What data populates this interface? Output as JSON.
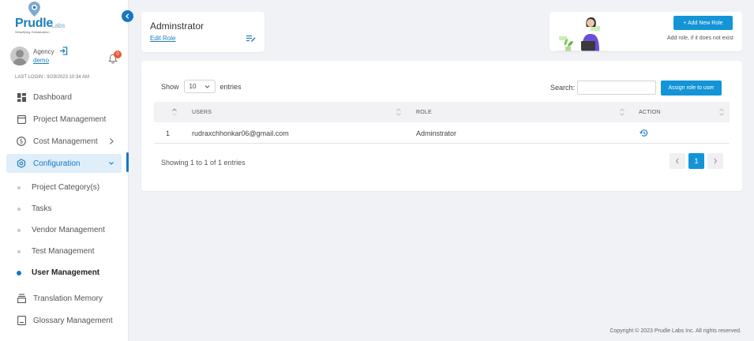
{
  "logo": {
    "brand": "Prudle",
    "brand_suffix": "Labs",
    "tagline": "Simplifying Globalization"
  },
  "user": {
    "role": "Agency",
    "name": "demo",
    "notifications": "0"
  },
  "last_login": "LAST LOGIN : 9/29/2023 10:34 AM",
  "sidebar": {
    "items": [
      {
        "label": "Dashboard",
        "icon": "dashboard-icon"
      },
      {
        "label": "Project Management",
        "icon": "project-icon"
      },
      {
        "label": "Cost Management",
        "icon": "dollar-icon"
      },
      {
        "label": "Configuration",
        "icon": "gear-icon"
      }
    ],
    "sub_items": [
      {
        "label": "Project Category(s)"
      },
      {
        "label": "Tasks"
      },
      {
        "label": "Vendor Management"
      },
      {
        "label": "Test Management"
      },
      {
        "label": "User Management"
      }
    ],
    "bottom_items": [
      {
        "label": "Translation Memory",
        "icon": "memory-icon"
      },
      {
        "label": "Glossary Management",
        "icon": "glossary-icon"
      }
    ]
  },
  "header": {
    "title": "Adminstrator",
    "edit_link": "Edit Role"
  },
  "role_card": {
    "button": "+ Add New Role",
    "hint": "Add role, if it does not exist"
  },
  "table": {
    "show_label": "Show",
    "entries_label": "entries",
    "page_length": "10",
    "search_label": "Search:",
    "assign_button": "Assign role to user",
    "columns": [
      "USERS",
      "ROLE",
      "ACTION"
    ],
    "rows": [
      {
        "index": "1",
        "user": "rudraxchhonkar06@gmail.com",
        "role": "Adminstrator"
      }
    ],
    "info": "Showing 1 to 1 of 1 entries",
    "current_page": "1"
  },
  "footer": "Copyright © 2023 Prudle Labs Inc. All rights reserved.",
  "colors": {
    "primary": "#1394d6",
    "link": "#1b7fb7",
    "active_bg": "#dfeef9",
    "badge": "#e85a3a"
  }
}
